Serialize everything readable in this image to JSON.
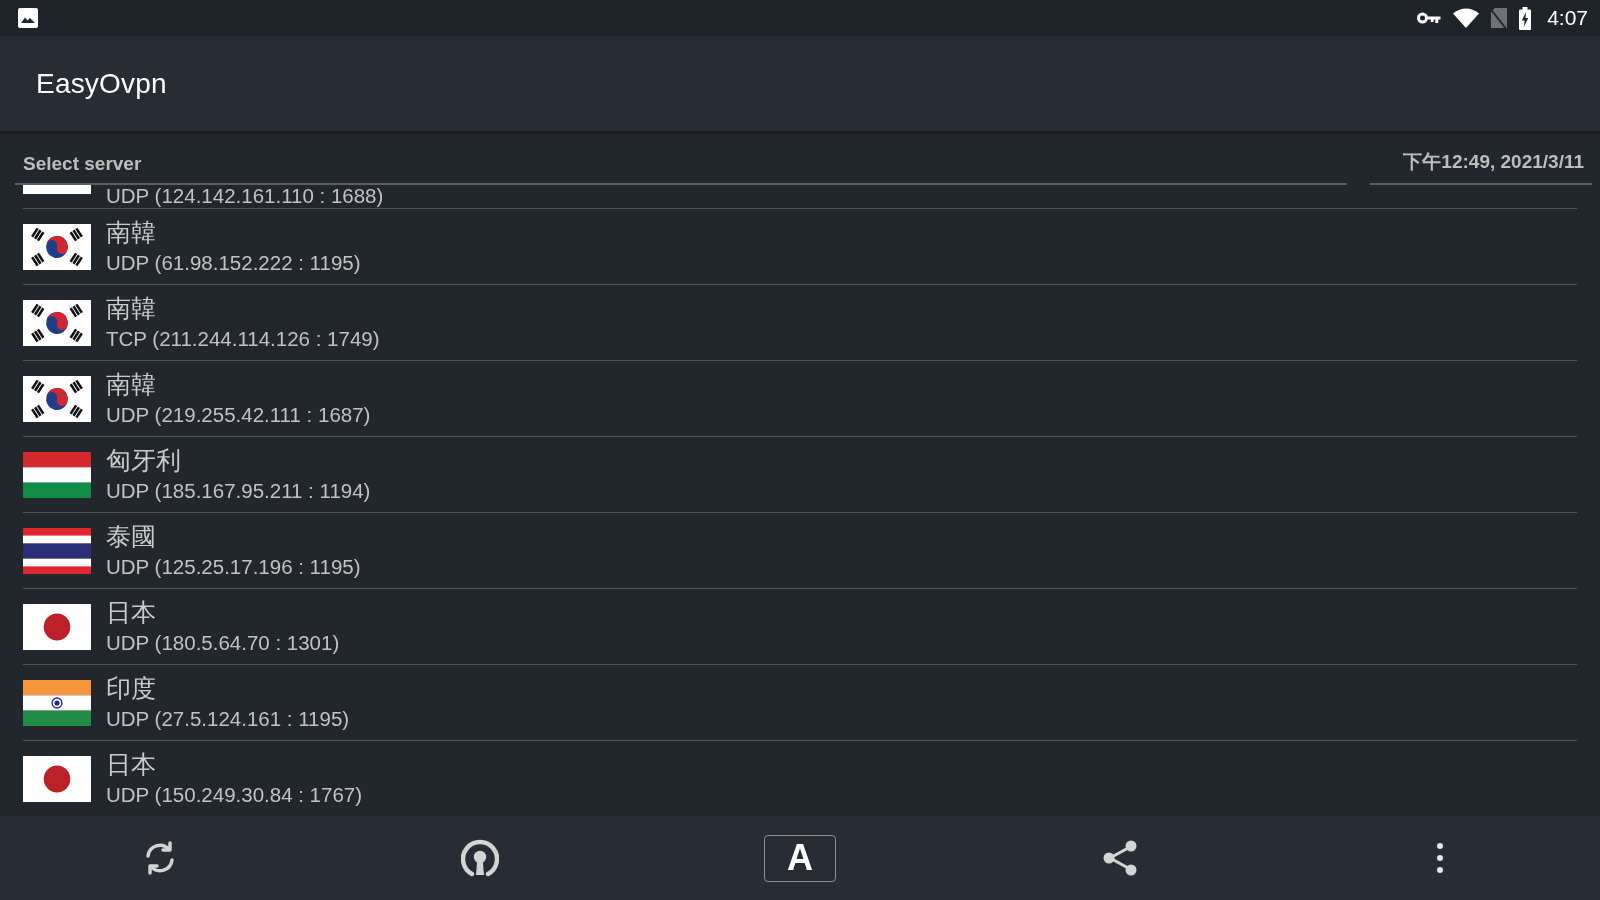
{
  "status_bar": {
    "time": "4:07"
  },
  "app_bar": {
    "title": "EasyOvpn"
  },
  "list_header": {
    "title": "Select server",
    "updated": "下午12:49, 2021/3/11"
  },
  "servers": [
    {
      "kind": "cropped",
      "address": "UDP (124.142.161.110 : 1688)"
    },
    {
      "kind": "korea",
      "country": "南韓",
      "address": "UDP (61.98.152.222 : 1195)"
    },
    {
      "kind": "korea",
      "country": "南韓",
      "address": "TCP (211.244.114.126 : 1749)"
    },
    {
      "kind": "korea",
      "country": "南韓",
      "address": "UDP (219.255.42.111 : 1687)"
    },
    {
      "kind": "hungary",
      "country": "匈牙利",
      "address": "UDP (185.167.95.211 : 1194)"
    },
    {
      "kind": "thailand",
      "country": "泰國",
      "address": "UDP (125.25.17.196 : 1195)"
    },
    {
      "kind": "japan",
      "country": "日本",
      "address": "UDP (180.5.64.70 : 1301)"
    },
    {
      "kind": "india",
      "country": "印度",
      "address": "UDP (27.5.124.161 : 1195)"
    },
    {
      "kind": "japan",
      "country": "日本",
      "address": "UDP (150.249.30.84 : 1767)"
    }
  ],
  "bottom_bar": {
    "text_button": "A"
  }
}
